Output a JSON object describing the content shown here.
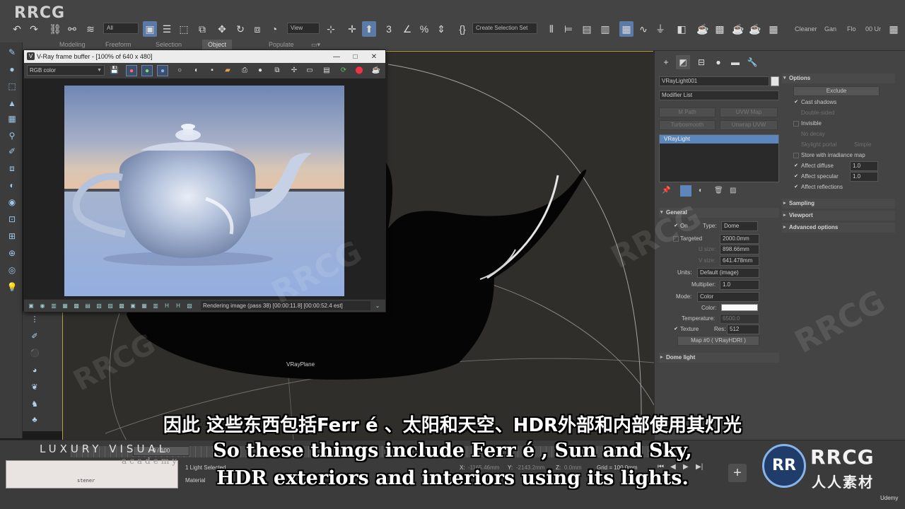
{
  "watermark": {
    "logo": "RRCG"
  },
  "toolbar": {
    "filter_dropdown": "All",
    "view_dropdown": "View",
    "selection_set": "Create Selection Set",
    "right_items": [
      "Cleaner",
      "Gan",
      "Flo",
      "00 Ur"
    ]
  },
  "ribbon": {
    "tabs": [
      "Modeling",
      "Freeform",
      "Selection",
      "Object Paint",
      "Populate"
    ],
    "active": "Object Paint"
  },
  "vfb": {
    "title": "V-Ray frame buffer - [100% of 640 x 480]",
    "channel": "RGB color",
    "status": "Rendering image (pass 38) [00:00:11.8] [00:00:52.4 est]"
  },
  "viewport": {
    "plane_label": "VRayPlane"
  },
  "command_panel": {
    "object_name": "VRayLight001",
    "modifier_list": "Modifier List",
    "modifier_buttons": [
      "M Path",
      "UVW Map",
      "Turbosmooth",
      "Unwrap UVW"
    ],
    "stack_item": "VRayLight",
    "general": {
      "header": "General",
      "on_label": "On",
      "type_label": "Type:",
      "type_value": "Dome",
      "targeted_label": "Targeted",
      "targeted_value": "2000.0mm",
      "usize_label": "U size:",
      "usize_value": "898.66mm",
      "vsize_label": "V size:",
      "vsize_value": "641.478mm",
      "units_label": "Units:",
      "units_value": "Default (image)",
      "multiplier_label": "Multiplier:",
      "multiplier_value": "1.0",
      "mode_label": "Mode:",
      "mode_value": "Color",
      "color_label": "Color:",
      "color_hex": "#fafafa",
      "temperature_label": "Temperature:",
      "temperature_value": "6500.0",
      "texture_label": "Texture",
      "res_label": "Res:",
      "res_value": "512",
      "map_button": "Map #0 ( VRayHDRI )"
    },
    "dome_light_header": "Dome light",
    "options": {
      "header": "Options",
      "exclude_button": "Exclude",
      "items": [
        "Cast shadows",
        "Double-sided",
        "Invisible",
        "No decay",
        "Skylight portal",
        "Store with irradiance map",
        "Affect diffuse",
        "Affect specular",
        "Affect reflections"
      ],
      "simple_label": "Simple",
      "affect_diffuse_value": "1.0",
      "affect_specular_value": "1.0"
    },
    "sampling_header": "Sampling",
    "viewport_header": "Viewport",
    "advanced_header": "Advanced options"
  },
  "status": {
    "frame_range": "0 / 100",
    "selected": "1 Light Selected",
    "material_label": "Material",
    "script_line": "stener",
    "x_label": "X:",
    "x_value": "-1165.46mm",
    "y_label": "Y:",
    "y_value": "-2143.2mm",
    "z_label": "Z:",
    "z_value": "0.0mm",
    "grid": "Grid = 100.0mm"
  },
  "branding": {
    "lux": "LUXURY VISUAL",
    "academy": "academy",
    "rrcg_mark": "RR",
    "rrcg_text": "RRCG",
    "rrcg_cn": "人人素材",
    "udemy": "Udemy"
  },
  "subtitles": {
    "cn": "因此 这些东西包括Ferr é 、太阳和天空、HDR外部和内部使用其灯光",
    "en1": "So these things include Ferr é , Sun and Sky,",
    "en2": "HDR exteriors and interiors using its lights."
  }
}
